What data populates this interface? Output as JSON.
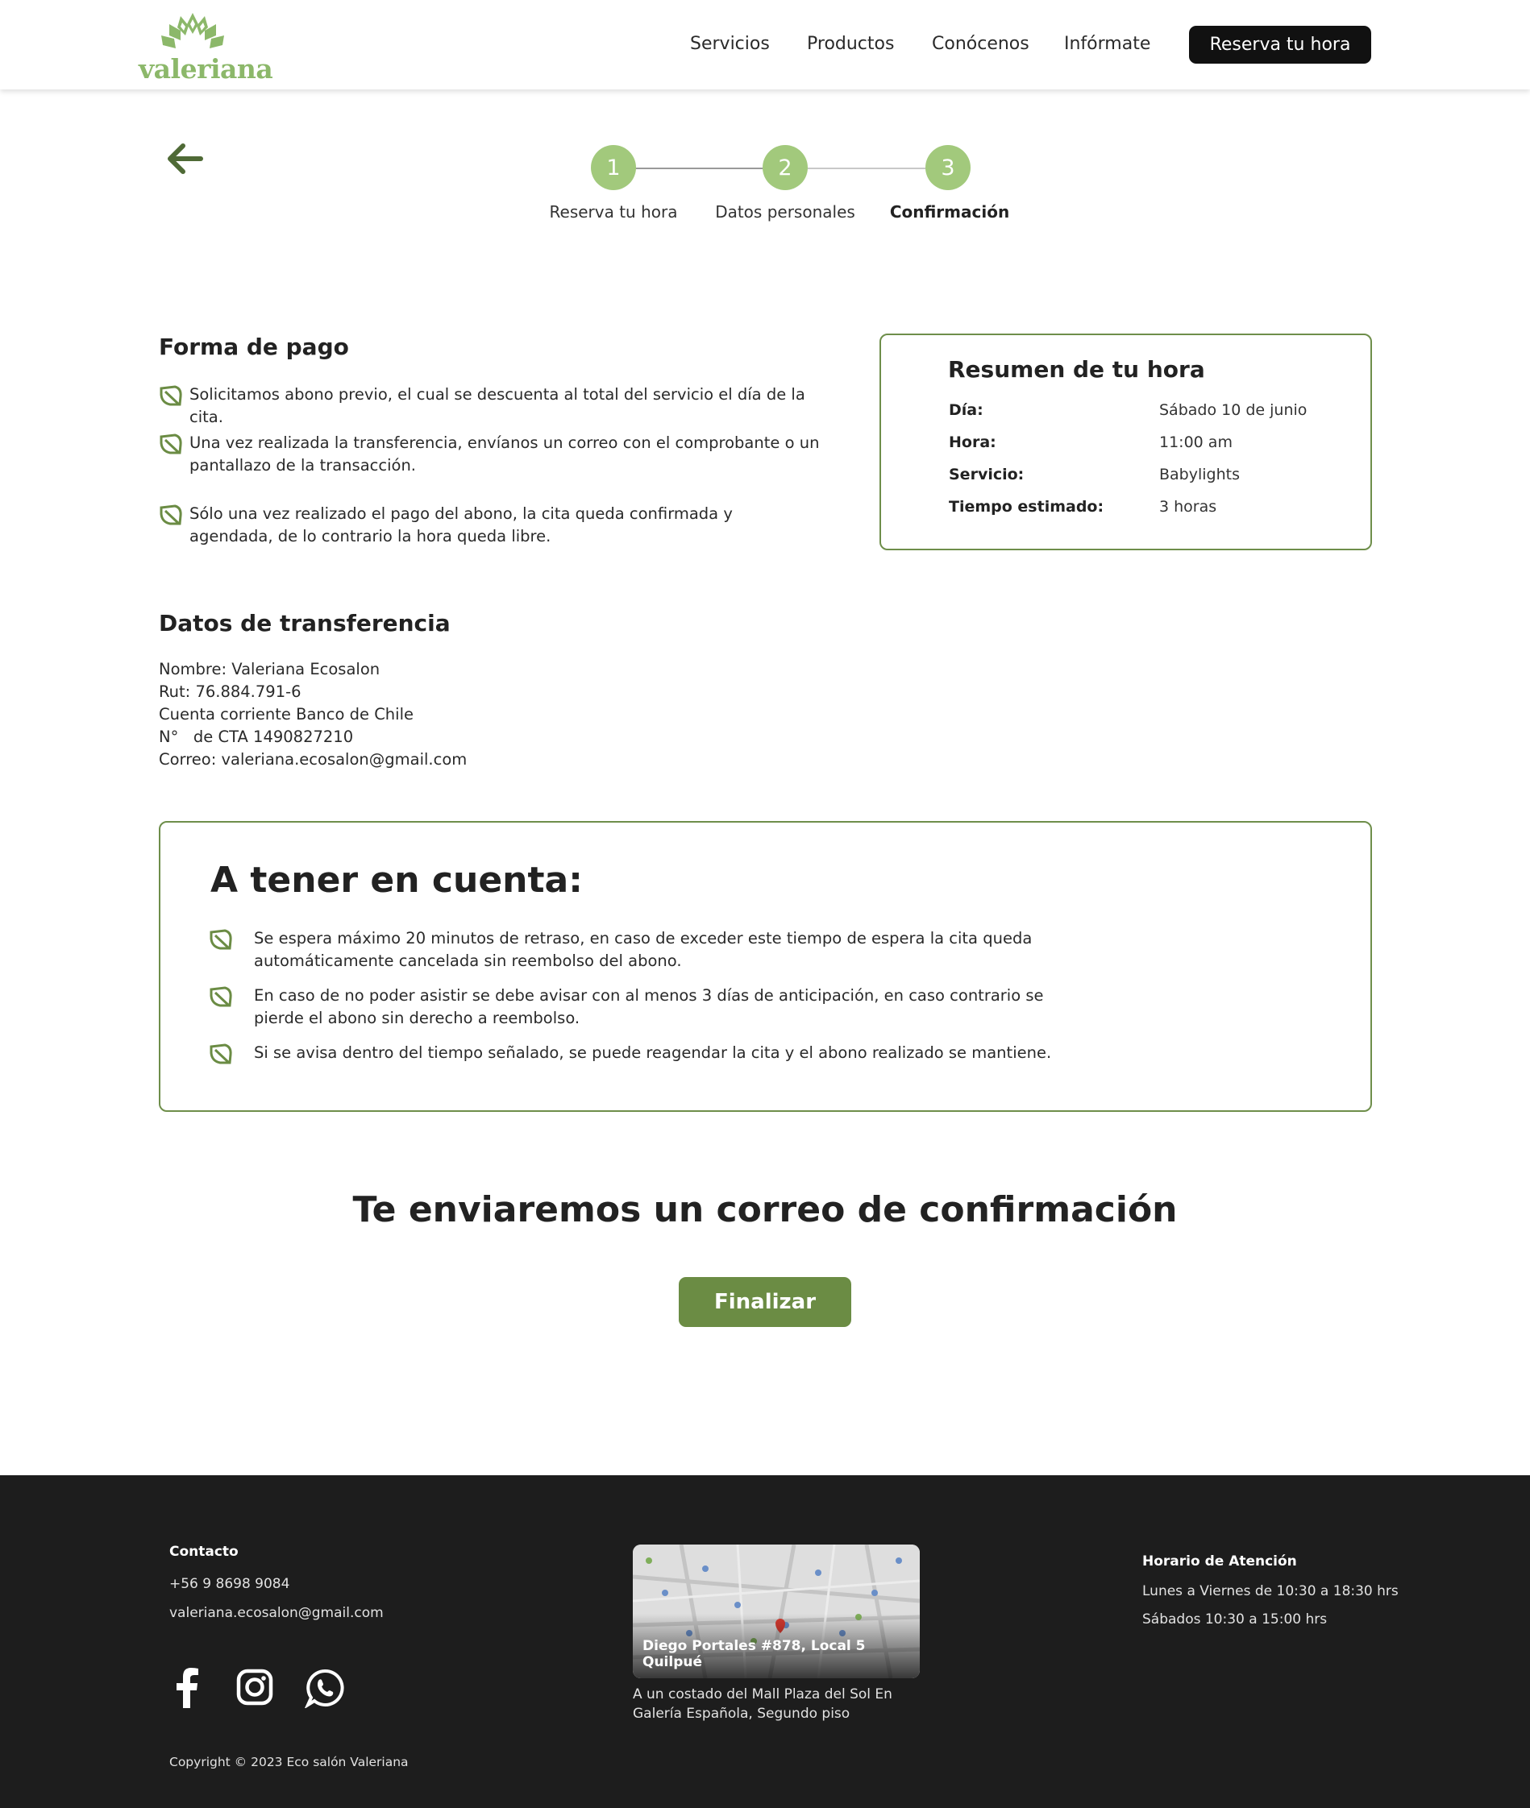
{
  "header": {
    "logo_text": "valeriana",
    "nav": [
      "Servicios",
      "Productos",
      "Conócenos",
      "Infórmate"
    ],
    "cta": "Reserva tu hora"
  },
  "stepper": {
    "steps": [
      {
        "number": "1",
        "label": "Reserva tu hora"
      },
      {
        "number": "2",
        "label": "Datos personales"
      },
      {
        "number": "3",
        "label": "Confirmación"
      }
    ],
    "active_step": 3
  },
  "payment": {
    "title": "Forma de pago",
    "items": [
      "Solicitamos abono previo, el cual se descuenta al total del servicio el día de la cita.",
      "Una vez realizada la transferencia, envíanos un correo con el comprobante o un pantallazo de la transacción.",
      "Sólo una vez realizado el pago del abono, la cita queda confirmada y agendada, de lo contrario la hora queda libre."
    ]
  },
  "summary": {
    "title": "Resumen de tu hora",
    "rows": [
      {
        "label": "Día:",
        "value": "Sábado 10 de junio"
      },
      {
        "label": "Hora:",
        "value": "11:00 am"
      },
      {
        "label": "Servicio:",
        "value": "Babylights"
      },
      {
        "label": "Tiempo estimado:",
        "value": "3 horas"
      }
    ]
  },
  "transfer": {
    "title": "Datos de transferencia",
    "lines": [
      "Nombre: Valeriana Ecosalon",
      "Rut: 76.884.791-6",
      "Cuenta corriente Banco de Chile",
      "N°   de CTA 1490827210",
      "Correo: valeriana.ecosalon@gmail.com"
    ]
  },
  "notice": {
    "title": "A tener en cuenta:",
    "items": [
      "Se espera máximo 20 minutos de retraso, en caso de exceder este tiempo de espera la cita queda automáticamente cancelada sin reembolso del abono.",
      "En caso de no poder asistir se debe avisar con al menos 3 días de anticipación, en caso contrario se pierde el abono sin derecho a reembolso.",
      "Si se avisa dentro del tiempo señalado, se puede reagendar la cita y el abono realizado se mantiene."
    ]
  },
  "confirmation": {
    "title": "Te enviaremos un correo de confirmación",
    "button": "Finalizar"
  },
  "footer": {
    "contact_title": "Contacto",
    "phone": "+56 9 8698 9084",
    "email": "valeriana.ecosalon@gmail.com",
    "social_icons": [
      "facebook-icon",
      "instagram-icon",
      "whatsapp-icon"
    ],
    "map_label": "Diego Portales #878, Local 5 Quilpué",
    "address_note": "A un costado del Mall Plaza del Sol En Galería Española, Segundo piso",
    "hours_title": "Horario de Atención",
    "hours": [
      "Lunes a Viernes de 10:30 a 18:30 hrs",
      "Sábados 10:30 a 15:00 hrs"
    ],
    "copyright": "Copyright © 2023 Eco salón Valeriana"
  },
  "colors": {
    "accent_green": "#6b8c44",
    "step_green": "#a2c97c",
    "border_green": "#6e8e4a",
    "footer_bg": "#1d1d1d"
  }
}
